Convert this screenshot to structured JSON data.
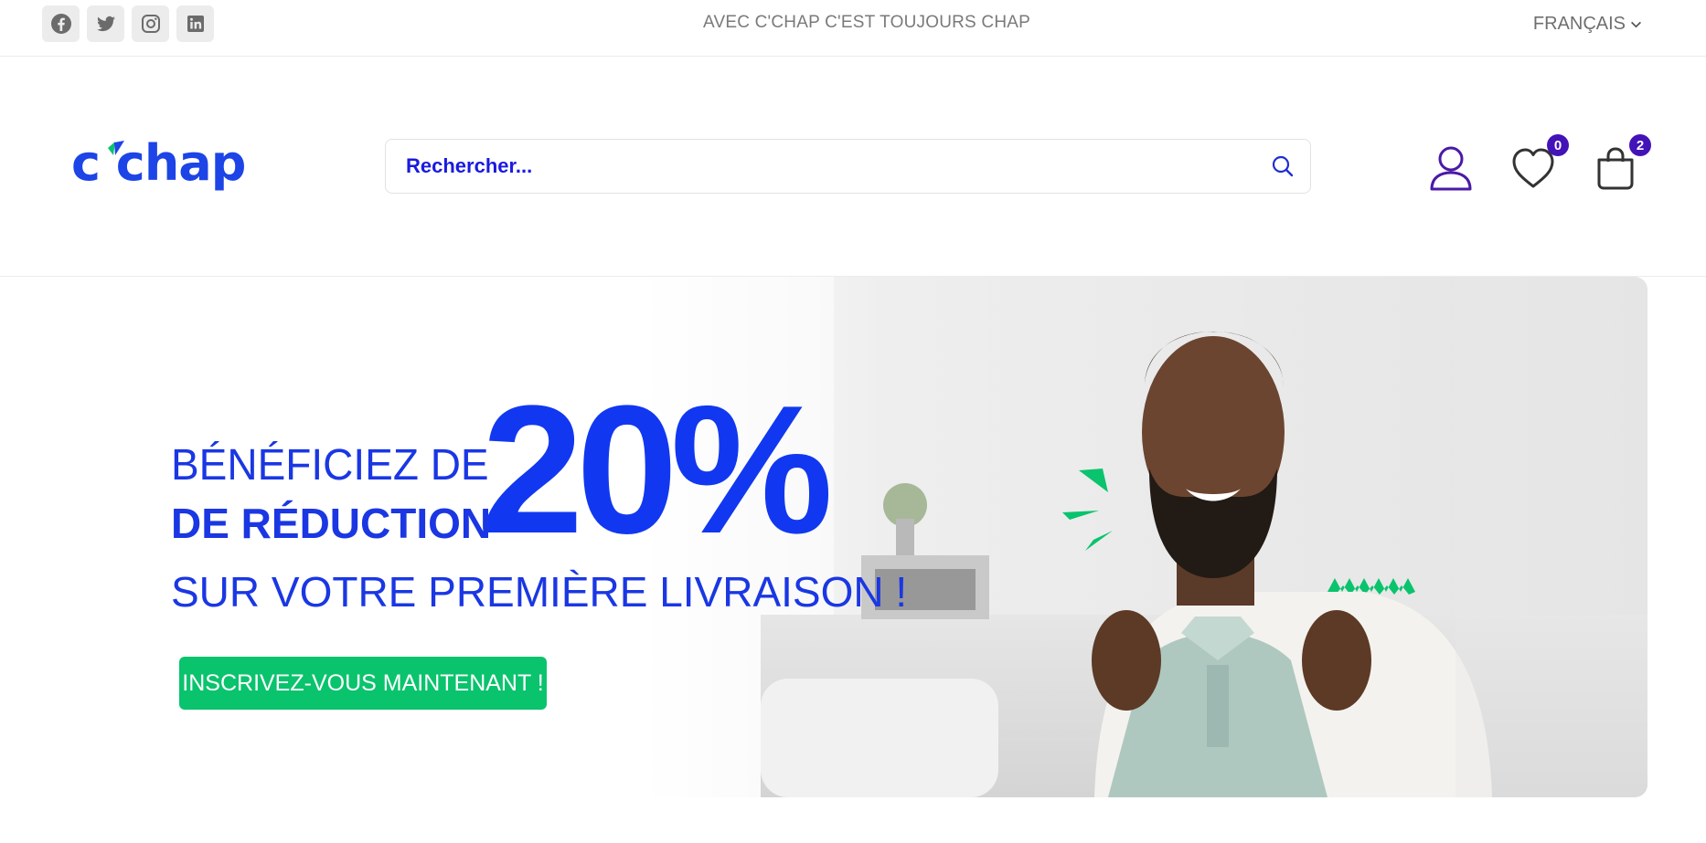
{
  "topbar": {
    "socials": [
      {
        "name": "facebook-icon"
      },
      {
        "name": "twitter-icon"
      },
      {
        "name": "instagram-icon"
      },
      {
        "name": "linkedin-icon"
      }
    ],
    "tagline": "AVEC C'CHAP C'EST TOUJOURS CHAP",
    "language": "FRANÇAIS"
  },
  "header": {
    "logo_text": "c’chap",
    "search_placeholder": "Rechercher...",
    "wishlist_count": "0",
    "cart_count": "2"
  },
  "banner": {
    "line1": "BÉNÉFICIEZ DE",
    "line2": "DE RÉDUCTION",
    "percent": "20%",
    "line3": "SUR VOTRE PREMIÈRE LIVRAISON !",
    "cta": "INSCRIVEZ-VOUS MAINTENANT !"
  },
  "colors": {
    "brand_blue": "#1c44e6",
    "badge_purple": "#4313b8",
    "cta_green": "#0ac36d"
  }
}
